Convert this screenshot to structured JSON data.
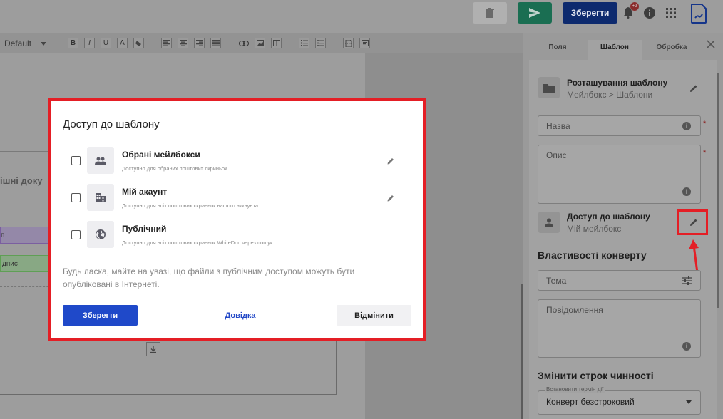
{
  "topbar": {
    "save_label": "Зберегти",
    "notification_badge": "+9",
    "accent_colors": {
      "save": "#0d2a6e",
      "send": "#1a6e52"
    }
  },
  "editor": {
    "font_select": "Default",
    "toolbar_icons": [
      "bold-icon",
      "italic-icon",
      "underline-icon",
      "text-color-icon",
      "fill-icon",
      "align-left-icon",
      "align-center-icon",
      "align-right-icon",
      "justify-icon",
      "link-icon",
      "image-icon",
      "table-icon",
      "ordered-list-icon",
      "unordered-list-icon",
      "page-break-icon",
      "field-icon"
    ],
    "bold_glyph": "B",
    "italic_glyph": "I",
    "underline_glyph": "U",
    "text_color_glyph": "A",
    "doc_heading": "ішні доку",
    "field_purple": "п",
    "field_green": "дпис"
  },
  "panel": {
    "tabs": [
      "Поля",
      "Шаблон",
      "Обробка"
    ],
    "active_tab": "Шаблон",
    "location": {
      "title": "Розташування шаблону",
      "path": "Мейлбокс > Шаблони"
    },
    "name_label": "Назва",
    "description_label": "Опис",
    "access": {
      "title": "Доступ до шаблону",
      "value": "Мій мейлбокс"
    },
    "envelope_section": "Властивості конверту",
    "subject_label": "Тема",
    "message_label": "Повідомлення",
    "expiry_section": "Змінити строк чинності",
    "expiry_field_label": "Встановити термін дії",
    "expiry_value": "Конверт безстроковий"
  },
  "dialog": {
    "title": "Доступ до шаблону",
    "options": [
      {
        "title": "Обрані мейлбокси",
        "desc": "Доступно для обраних поштових скриньок.",
        "icon": "group-icon"
      },
      {
        "title": "Мій акаунт",
        "desc": "Доступно для всіх поштових скриньок вашого аккаунта.",
        "icon": "building-icon"
      },
      {
        "title": "Публічний",
        "desc": "Доступно для всіх поштових скриньок WhiteDoc через пошук.",
        "icon": "globe-icon"
      }
    ],
    "note": "Будь ласка, майте на увазі, що файли з публічним доступом можуть бути опубліковані в Інтернеті.",
    "save_label": "Зберегти",
    "help_label": "Довідка",
    "cancel_label": "Відмінити",
    "colors": {
      "primary": "#1f49c9",
      "highlight": "#e41e25"
    }
  }
}
